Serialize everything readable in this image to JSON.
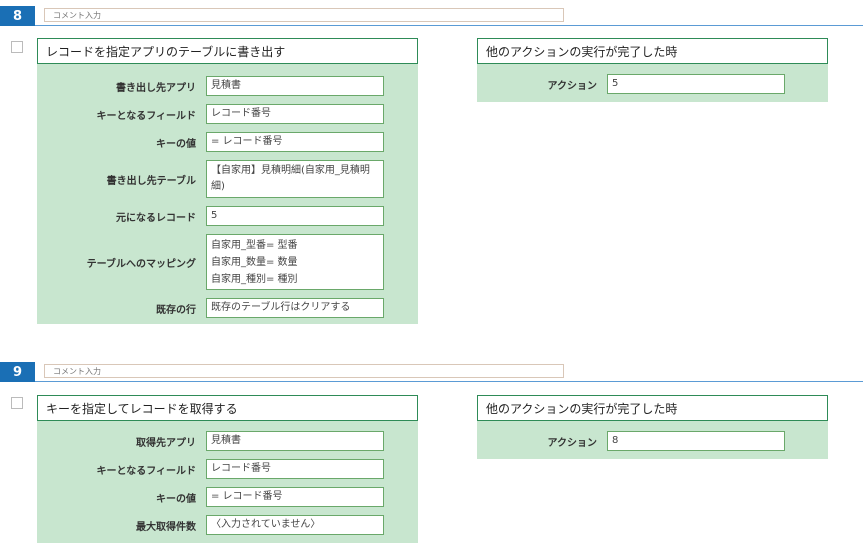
{
  "sections": [
    {
      "number": "8",
      "comment_placeholder": "コメント入力",
      "left_panel": {
        "title": "レコードを指定アプリのテーブルに書き出す",
        "fields": [
          {
            "label": "書き出し先アプリ",
            "value": "見積書"
          },
          {
            "label": "キーとなるフィールド",
            "value": "レコード番号"
          },
          {
            "label": "キーの値",
            "value": "= レコード番号"
          },
          {
            "label": "書き出し先テーブル",
            "value": "【自家用】見積明細(自家用_見積明細)"
          },
          {
            "label": "元になるレコード",
            "value": "5"
          },
          {
            "label": "テーブルへのマッピング",
            "values": [
              "自家用_型番= 型番",
              "自家用_数量= 数量",
              "自家用_種別= 種別"
            ]
          },
          {
            "label": "既存の行",
            "value": "既存のテーブル行はクリアする"
          }
        ]
      },
      "right_panel": {
        "title": "他のアクションの実行が完了した時",
        "fields": [
          {
            "label": "アクション",
            "value": "5"
          }
        ]
      }
    },
    {
      "number": "9",
      "comment_placeholder": "コメント入力",
      "left_panel": {
        "title": "キーを指定してレコードを取得する",
        "fields": [
          {
            "label": "取得先アプリ",
            "value": "見積書"
          },
          {
            "label": "キーとなるフィールド",
            "value": "レコード番号"
          },
          {
            "label": "キーの値",
            "value": "= レコード番号"
          },
          {
            "label": "最大取得件数",
            "value": "〈入力されていません〉"
          }
        ]
      },
      "right_panel": {
        "title": "他のアクションの実行が完了した時",
        "fields": [
          {
            "label": "アクション",
            "value": "8"
          }
        ]
      }
    }
  ]
}
